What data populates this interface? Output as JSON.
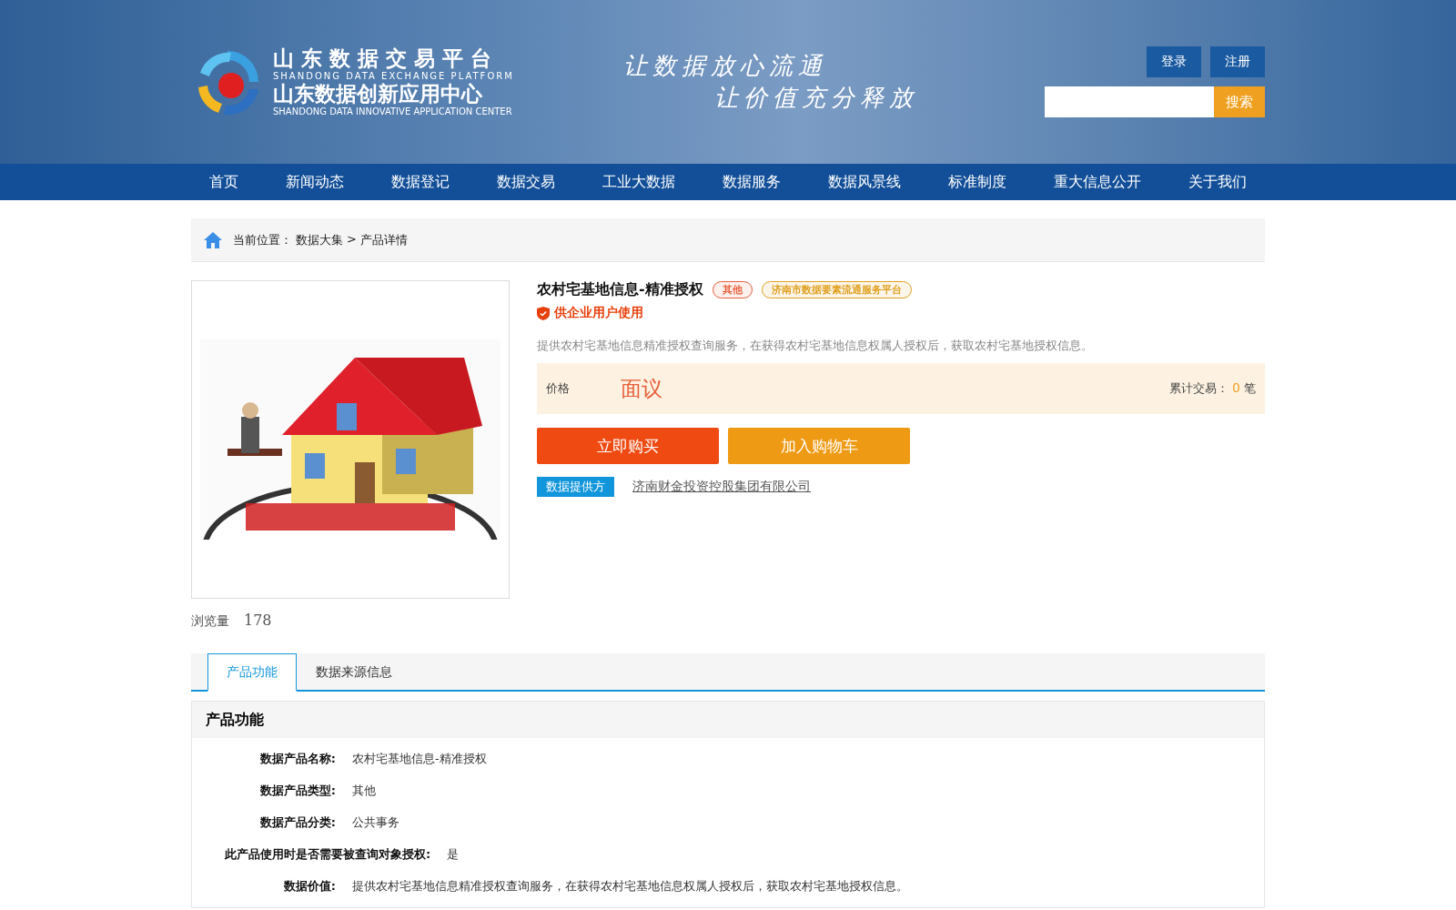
{
  "header": {
    "logo_title": "山 东 数 据 交 易 平 台",
    "logo_subtitle": "SHANDONG DATA EXCHANGE PLATFORM",
    "logo_title2": "山东数据创新应用中心",
    "logo_subtitle2": "SHANDONG DATA INNOVATIVE APPLICATION CENTER",
    "slogans": [
      "让数据放心流通",
      "让价值充分释放"
    ],
    "buttons": [
      "登录",
      "注册"
    ],
    "search_button": "搜索"
  },
  "nav": [
    "首页",
    "新闻动态",
    "数据登记",
    "数据交易",
    "工业大数据",
    "数据服务",
    "数据风景线",
    "标准制度",
    "重大信息公开",
    "关于我们"
  ],
  "breadcrumb": {
    "label": "当前位置：",
    "items": [
      "数据大集",
      "产品详情"
    ],
    "separator": ">"
  },
  "product": {
    "title": "农村宅基地信息-精准授权",
    "tags": [
      {
        "label": "其他",
        "color": "#e8603c"
      },
      {
        "label": "济南市数据要素流通服务平台",
        "color": "#e0a020"
      }
    ],
    "audience": "供企业用户使用",
    "description": "提供农村宅基地信息精准授权查询服务，在获得农村宅基地信息权属人授权后，获取农村宅基地授权信息。",
    "price_label": "价格",
    "price": "面议",
    "trade_label": "累计交易：",
    "trade_count": "0",
    "trade_unit": "笔",
    "buttons": [
      {
        "label": "立即购买",
        "kind": "buy"
      },
      {
        "label": "加入购物车",
        "kind": "cart"
      }
    ],
    "provider_label": "数据提供方",
    "provider": "济南财金投资控股集团有限公司"
  },
  "views": {
    "label": "浏览量",
    "value": "178"
  },
  "tabs": [
    {
      "label": "产品功能",
      "selected": true
    },
    {
      "label": "数据来源信息",
      "selected": false
    }
  ],
  "section": {
    "title": "产品功能",
    "rows": [
      {
        "label": "数据产品名称:",
        "value": "农村宅基地信息-精准授权"
      },
      {
        "label": "数据产品类型:",
        "value": "其他"
      },
      {
        "label": "数据产品分类:",
        "value": "公共事务"
      },
      {
        "label": "此产品使用时是否需要被查询对象授权:",
        "value": "是"
      },
      {
        "label": "数据价值:",
        "value": "提供农村宅基地信息精准授权查询服务，在获得农村宅基地信息权属人授权后，获取农村宅基地授权信息。"
      }
    ]
  }
}
